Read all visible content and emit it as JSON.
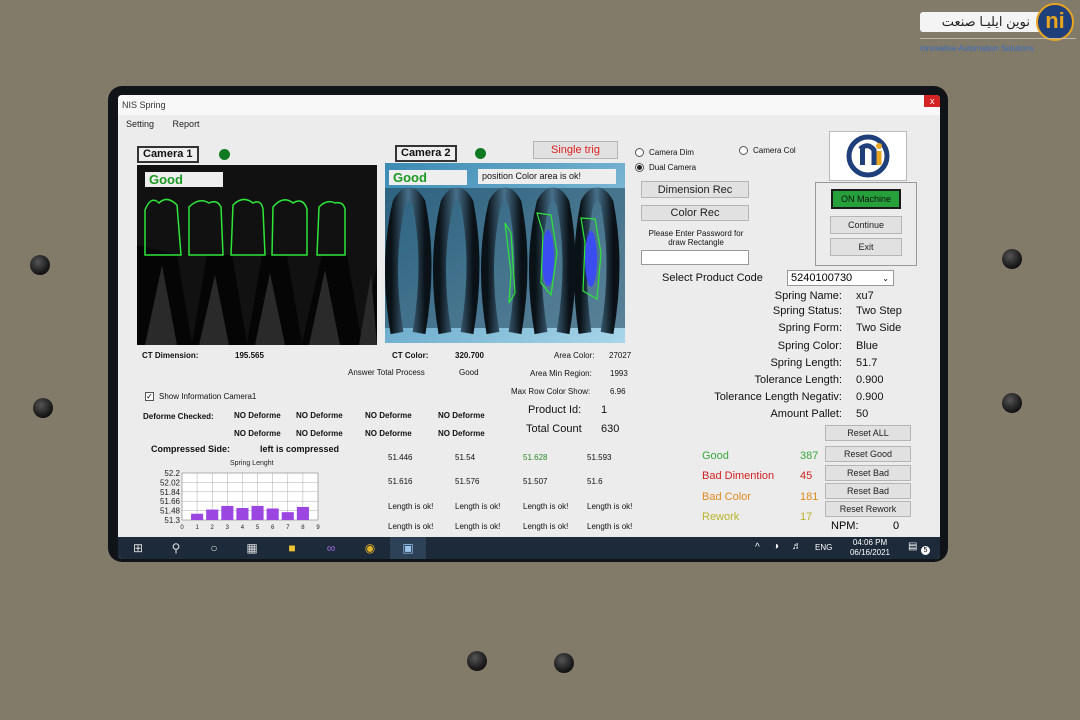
{
  "branding": {
    "company_name": "نوین ایلیـا صنعت",
    "tagline": "Innovative Automation Solutions",
    "logo_letter": "ni"
  },
  "window": {
    "title": "NIS Spring",
    "close_label": "x"
  },
  "menu": [
    "Setting",
    "Report"
  ],
  "camera1": {
    "label": "Camera 1",
    "status": "Good",
    "ct_label": "CT Dimension:",
    "ct_value": "195.565"
  },
  "camera2": {
    "label": "Camera 2",
    "status": "Good",
    "message": "position Color area is ok!",
    "ct_label": "CT Color:",
    "ct_value": "320.700"
  },
  "single_trig_label": "Single trig",
  "camera_mode": {
    "options": [
      "Camera Dim",
      "Camera Col",
      "Dual Camera"
    ],
    "selected": "Dual Camera"
  },
  "rec_buttons": {
    "dimension": "Dimension Rec",
    "color": "Color Rec"
  },
  "password": {
    "prompt": "Please Enter Password for draw Rectangle",
    "value": ""
  },
  "machine": {
    "on_label": "ON Machine",
    "continue_label": "Continue",
    "exit_label": "Exit"
  },
  "product": {
    "select_label": "Select Product Code",
    "code": "5240100730"
  },
  "spring_info": [
    {
      "label": "Spring Name:",
      "value": "xu7"
    },
    {
      "label": "Spring Status:",
      "value": "Two Step"
    },
    {
      "label": "Spring Form:",
      "value": "Two Side"
    },
    {
      "label": "Spring Color:",
      "value": "Blue"
    },
    {
      "label": "Spring Length:",
      "value": "51.7"
    },
    {
      "label": "Tolerance Length:",
      "value": "0.900"
    },
    {
      "label": "Tolerance Length Negativ:",
      "value": "0.900"
    },
    {
      "label": "Amount Pallet:",
      "value": "50"
    }
  ],
  "process": {
    "answer_label": "Answer Total Process",
    "answer_value": "Good",
    "area_color_label": "Area Color:",
    "area_color_value": "27027",
    "area_min_label": "Area Min Region:",
    "area_min_value": "1993",
    "max_row_label": "Max Row Color Show:",
    "max_row_value": "6.96"
  },
  "show_info": {
    "label": "Show Information Camera1",
    "checked": true
  },
  "deforme": {
    "label": "Deforme Checked:",
    "row1": [
      "NO Deforme",
      "NO Deforme",
      "NO Deforme",
      "NO Deforme"
    ],
    "row2": [
      "NO Deforme",
      "NO Deforme",
      "NO Deforme",
      "NO Deforme"
    ]
  },
  "counts": {
    "product_id_label": "Product Id:",
    "product_id": "1",
    "total_label": "Total Count",
    "total": "630"
  },
  "compressed": {
    "label": "Compressed Side:",
    "value": "left is compressed"
  },
  "measurements": {
    "row1": [
      "51.446",
      "51.54",
      "51.628",
      "51.593"
    ],
    "row2": [
      "51.616",
      "51.576",
      "51.507",
      "51.6"
    ],
    "status_row1": [
      "Length is ok!",
      "Length is ok!",
      "Length is ok!",
      "Length is ok!"
    ],
    "status_row2": [
      "Length is ok!",
      "Length is ok!",
      "Length is ok!",
      "Length is ok!"
    ]
  },
  "stats": [
    {
      "label": "Good",
      "value": "387",
      "color": "#3aa83a",
      "reset": "Reset Good"
    },
    {
      "label": "Bad Dimention",
      "value": "45",
      "color": "#d21f1f",
      "reset": "Reset Bad"
    },
    {
      "label": "Bad Color",
      "value": "181",
      "color": "#e08a1e",
      "reset": "Reset Bad"
    },
    {
      "label": "Rework",
      "value": "17",
      "color": "#b9b52a",
      "reset": "Reset Rework"
    }
  ],
  "reset_all_label": "Reset ALL",
  "npm": {
    "label": "NPM:",
    "value": "0"
  },
  "taskbar": {
    "lang": "ENG",
    "time": "04:06 PM",
    "date": "06/16/2021",
    "notifications": "5"
  },
  "chart_data": {
    "type": "bar",
    "title": "Spring Lenght",
    "categories": [
      "0",
      "1",
      "2",
      "3",
      "4",
      "5",
      "6",
      "7",
      "8",
      "9"
    ],
    "y_ticks": [
      "52.2",
      "52.02",
      "51.84",
      "51.66",
      "51.48",
      "51.3"
    ],
    "ylim": [
      51.3,
      52.2
    ],
    "values": [
      null,
      51.42,
      51.5,
      51.57,
      51.53,
      51.57,
      51.52,
      51.45,
      51.55,
      null
    ],
    "bar_color": "#9b46e0",
    "grid": true
  }
}
